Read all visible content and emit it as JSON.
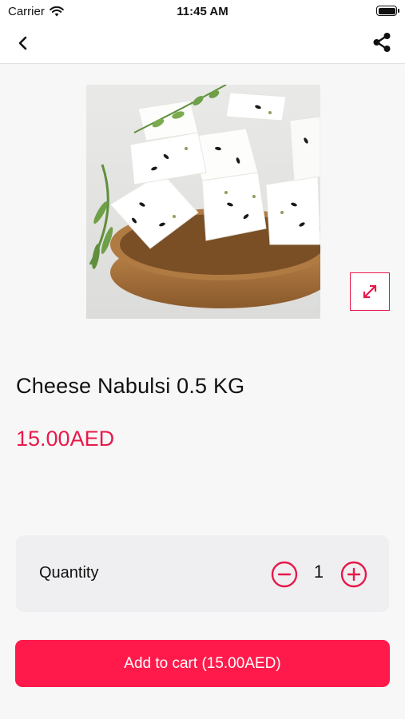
{
  "status_bar": {
    "carrier": "Carrier",
    "time": "11:45 AM",
    "battery_level": 1.0
  },
  "nav": {
    "back_icon": "chevron-left-icon",
    "share_icon": "share-icon"
  },
  "product": {
    "title": "Cheese Nabulsi 0.5 KG",
    "price": "15.00AED",
    "zoom_icon": "expand-icon"
  },
  "quantity": {
    "label": "Quantity",
    "value": "1",
    "minus_icon": "minus-circle-icon",
    "plus_icon": "plus-circle-icon"
  },
  "cart": {
    "button_label": "Add to cart (15.00AED)"
  },
  "colors": {
    "accent": "#e8194a",
    "button": "#ff1a4b",
    "background": "#f7f7f7",
    "card": "#efeff1"
  }
}
